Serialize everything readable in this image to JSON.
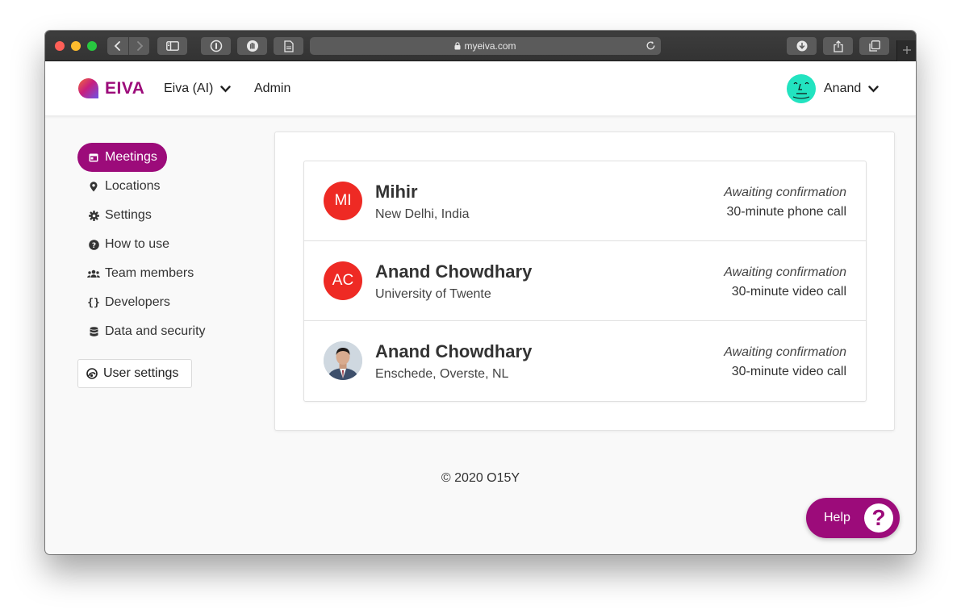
{
  "browser": {
    "url": "myeiva.com",
    "new_tab_icon": "plus"
  },
  "header": {
    "logo_text": "EIVA",
    "workspace_label": "Eiva (AI)",
    "admin_label": "Admin",
    "user_name": "Anand"
  },
  "sidebar": {
    "items": [
      {
        "label": "Meetings",
        "icon": "calendar-icon",
        "active": true
      },
      {
        "label": "Locations",
        "icon": "map-pin-icon"
      },
      {
        "label": "Settings",
        "icon": "gear-icon"
      },
      {
        "label": "How to use",
        "icon": "question-circle-icon"
      },
      {
        "label": "Team members",
        "icon": "users-icon"
      },
      {
        "label": "Developers",
        "icon": "braces-icon"
      },
      {
        "label": "Data and security",
        "icon": "database-icon"
      }
    ],
    "user_settings_label": "User settings"
  },
  "meetings": [
    {
      "initials": "MI",
      "name": "Mihir",
      "location": "New Delhi, India",
      "status": "Awaiting confirmation",
      "type": "30-minute phone call"
    },
    {
      "initials": "AC",
      "name": "Anand Chowdhary",
      "location": "University of Twente",
      "status": "Awaiting confirmation",
      "type": "30-minute video call"
    },
    {
      "initials": "",
      "name": "Anand Chowdhary",
      "location": "Enschede, Overste, NL",
      "status": "Awaiting confirmation",
      "type": "30-minute video call"
    }
  ],
  "footer": {
    "text": "© 2020 O15Y"
  },
  "help": {
    "label": "Help",
    "icon_glyph": "?"
  },
  "colors": {
    "brand": "#9c0b7a",
    "avatar_red": "#ee2a24",
    "user_avatar": "#22e3c0"
  }
}
